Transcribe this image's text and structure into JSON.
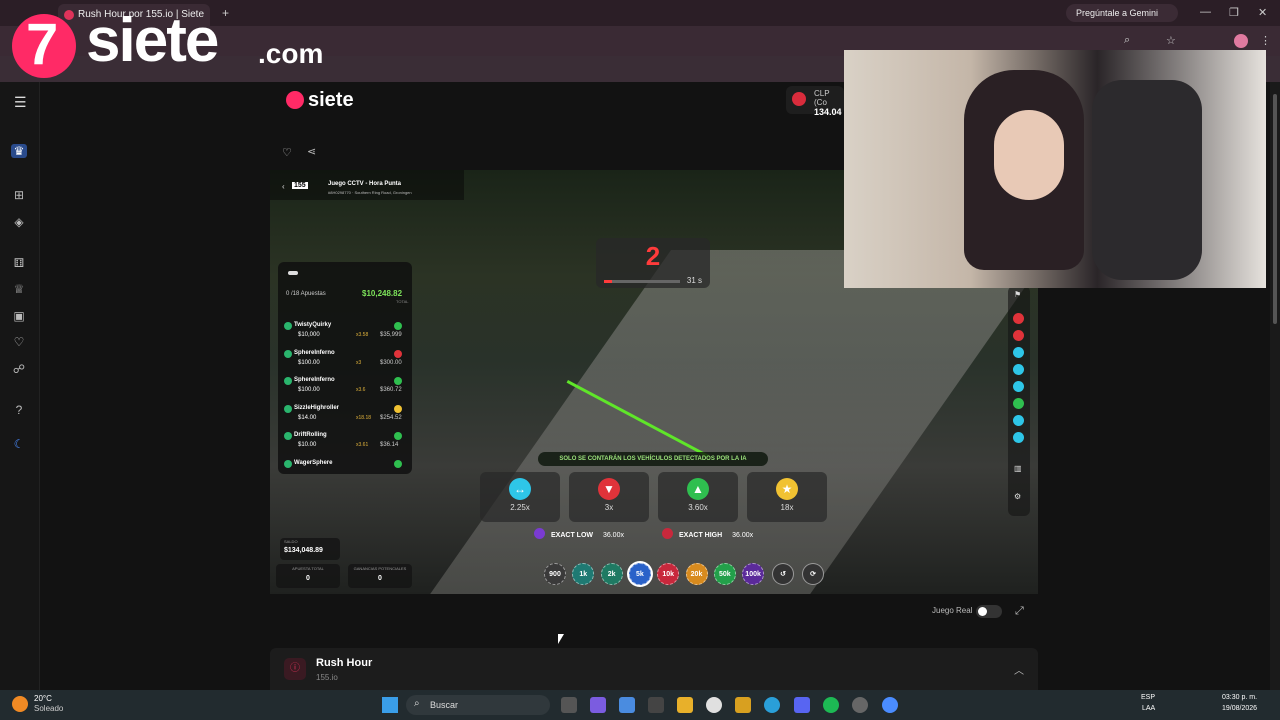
{
  "browser": {
    "tab_title": "Rush Hour por 155.io | Siete",
    "gemini_label": "Pregúntale a Gemini",
    "window_controls": [
      "minimize-icon",
      "maximize-icon",
      "close-icon"
    ]
  },
  "overlay": {
    "logo_digit": "7",
    "logo_word": "siete",
    "logo_suffix": ".com"
  },
  "site": {
    "logo_text": "siete",
    "balance_currency": "CLP (Co",
    "balance_value": "134.04",
    "sidebar_icons": [
      "crown-icon",
      "gift-icon",
      "medal-icon",
      "dice-icon",
      "trophy-icon",
      "video-icon",
      "heart-icon",
      "handshake-icon",
      "help-icon",
      "moon-icon"
    ],
    "actions": [
      "heart-icon",
      "share-icon"
    ]
  },
  "game": {
    "provider_badge": "155",
    "title": "Juego CCTV - Hora Punta",
    "location": "#8H0298770 · Southern Ring Road, Groningen",
    "timer_value": "2",
    "timer_seconds": "31 s",
    "bets_count_label": "0 /18 Apuestas",
    "bets_total": "$10,248.82",
    "bets_total_label": "TOTAL",
    "bets": [
      {
        "name": "TwistyQuirky",
        "amount": "$10,000",
        "multiplier": "x3.58",
        "win": "$35,999",
        "color": "#2fbf4f"
      },
      {
        "name": "SphereInferno",
        "amount": "$100.00",
        "multiplier": "x3",
        "win": "$300.00",
        "color": "#e0333a"
      },
      {
        "name": "SphereInferno",
        "amount": "$100.00",
        "multiplier": "x3.6",
        "win": "$360.72",
        "color": "#2fbf4f"
      },
      {
        "name": "SizzleHighroller",
        "amount": "$14.00",
        "multiplier": "x18.18",
        "win": "$254.52",
        "color": "#f1c232"
      },
      {
        "name": "DriftRolling",
        "amount": "$10.00",
        "multiplier": "x3.61",
        "win": "$36.14",
        "color": "#2fbf4f"
      },
      {
        "name": "WagerSphere",
        "amount": "",
        "multiplier": "",
        "win": "",
        "color": "#2fbf4f"
      }
    ],
    "ai_notice": "SOLO SE CONTARÁN LOS VEHÍCULOS DETECTADOS POR LA IA",
    "options": [
      {
        "icon": "arrows-horizontal-icon",
        "value": "2.25x",
        "color": "#2ec6e8"
      },
      {
        "icon": "arrow-down-icon",
        "value": "3x",
        "color": "#e0333a"
      },
      {
        "icon": "arrow-up-icon",
        "value": "3.60x",
        "color": "#2fbf4f"
      },
      {
        "icon": "star-icon",
        "value": "18x",
        "color": "#f1c232"
      }
    ],
    "exact_low_label": "EXACT LOW",
    "exact_low_value": "36.00x",
    "exact_high_label": "EXACT HIGH",
    "exact_high_value": "36.00x",
    "chips": [
      {
        "label": "900",
        "color": "#3a3a3a"
      },
      {
        "label": "1k",
        "color": "#1f7a73"
      },
      {
        "label": "2k",
        "color": "#1f7a63"
      },
      {
        "label": "5k",
        "color": "#2a62c9"
      },
      {
        "label": "10k",
        "color": "#c8283c"
      },
      {
        "label": "20k",
        "color": "#d88b1e"
      },
      {
        "label": "50k",
        "color": "#23a04a"
      },
      {
        "label": "100k",
        "color": "#5b2a9a"
      }
    ],
    "saldo_label": "SALDO",
    "saldo_value": "$134,048.89",
    "apuesta_label": "APUESTA TOTAL",
    "apuesta_value": "0",
    "ganancias_label": "GANANCIAS POTENCIALES",
    "ganancias_value": "0",
    "rail_colors": [
      "#e0333a",
      "#e0333a",
      "#2ec6e8",
      "#2ec6e8",
      "#2ec6e8",
      "#2fbf4f",
      "#2ec6e8",
      "#2ec6e8"
    ]
  },
  "below": {
    "juego_real_label": "Juego Real",
    "game_name": "Rush Hour",
    "provider": "155.io"
  },
  "taskbar": {
    "weather_temp": "20°C",
    "weather_desc": "Soleado",
    "search_label": "Buscar",
    "lang_top": "ESP",
    "lang_bottom": "LAA",
    "time": "03:30 p. m.",
    "date": "19/08/2026"
  }
}
